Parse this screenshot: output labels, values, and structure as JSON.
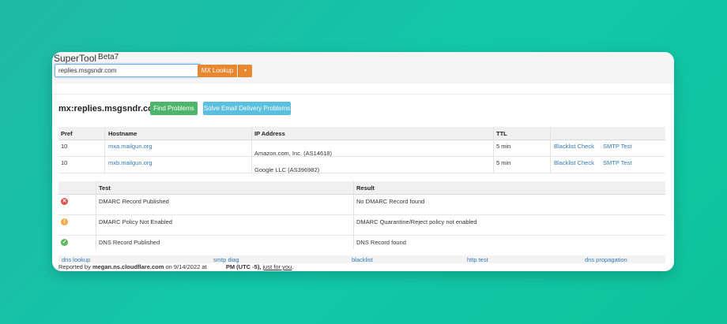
{
  "app": {
    "title": "SuperTool",
    "badge": "Beta7"
  },
  "search": {
    "value": "replies.msgsndr.com",
    "button_label": "MX Lookup",
    "caret": "▾"
  },
  "results": {
    "heading": "mx:replies.msgsndr.com",
    "find_button": "Find Problems",
    "solve_button": "Solve Email Delivery Problems"
  },
  "mx_table": {
    "headers": [
      "Pref",
      "Hostname",
      "IP Address",
      "TTL",
      ""
    ],
    "rows": [
      {
        "pref": "10",
        "hostname": "mxa.mailgun.org",
        "ip": "Amazon.com, Inc. (AS14618)",
        "ttl": "5 min",
        "blacklist": "Blacklist Check",
        "smtp": "SMTP Test"
      },
      {
        "pref": "10",
        "hostname": "mxb.mailgun.org",
        "ip": "Google LLC (AS396982)",
        "ttl": "5 min",
        "blacklist": "Blacklist Check",
        "smtp": "SMTP Test"
      }
    ]
  },
  "test_table": {
    "headers": [
      "",
      "Test",
      "Result"
    ],
    "rows": [
      {
        "status": "error",
        "icon": "x-circle-icon",
        "color": "#d9534f",
        "glyph": "✕",
        "test": "DMARC Record Published",
        "result": "No DMARC Record found"
      },
      {
        "status": "warning",
        "icon": "warning-circle-icon",
        "color": "#f0ad4e",
        "glyph": "!",
        "test": "DMARC Policy Not Enabled",
        "result": "DMARC Quarantine/Reject policy not enabled"
      },
      {
        "status": "ok",
        "icon": "check-circle-icon",
        "color": "#5cb85c",
        "glyph": "✓",
        "test": "DNS Record Published",
        "result": "DNS Record found"
      }
    ]
  },
  "footer": {
    "links": [
      "dns lookup",
      "smtp diag",
      "blacklist",
      "http test",
      "dns propagation"
    ],
    "reported_prefix": "Reported by",
    "reported_server": "megan.ns.cloudflare.com",
    "reported_on": "on 9/14/2022 at",
    "reported_time": "PM (UTC -5),",
    "reported_suffix": "just for you",
    "reported_end": "."
  },
  "colors": {
    "accent_orange": "#e8872e",
    "green": "#4fb56a",
    "blue": "#5bc0de",
    "link": "#337ab7",
    "background": "#12c7a8"
  }
}
